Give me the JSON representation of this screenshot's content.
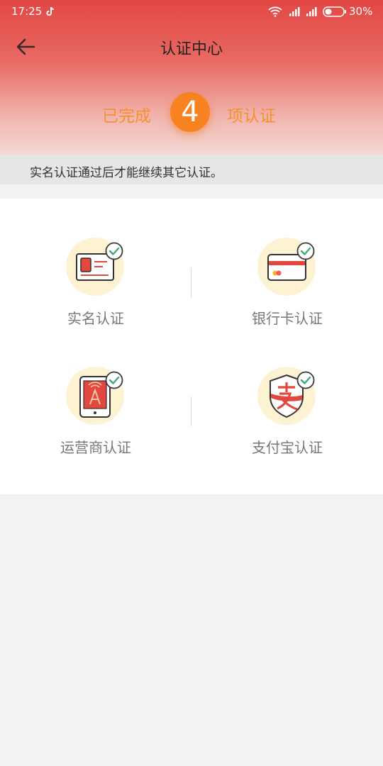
{
  "status_bar": {
    "time": "17:25",
    "battery": "30%"
  },
  "header": {
    "title": "认证中心"
  },
  "summary": {
    "prefix": "已完成",
    "count": "4",
    "suffix": "项认证"
  },
  "notice": {
    "text": "实名认证通过后才能继续其它认证。"
  },
  "items": [
    {
      "label": "实名认证",
      "icon": "id-card-icon",
      "completed": true
    },
    {
      "label": "银行卡认证",
      "icon": "bank-card-icon",
      "completed": true
    },
    {
      "label": "运营商认证",
      "icon": "phone-carrier-icon",
      "completed": true
    },
    {
      "label": "支付宝认证",
      "icon": "alipay-shield-icon",
      "completed": true
    }
  ],
  "colors": {
    "header_red": "#e24744",
    "accent_orange": "#f7821f",
    "icon_bg": "#fdf3d2",
    "check_green": "#3daa78",
    "illustration_red": "#e4473d"
  }
}
